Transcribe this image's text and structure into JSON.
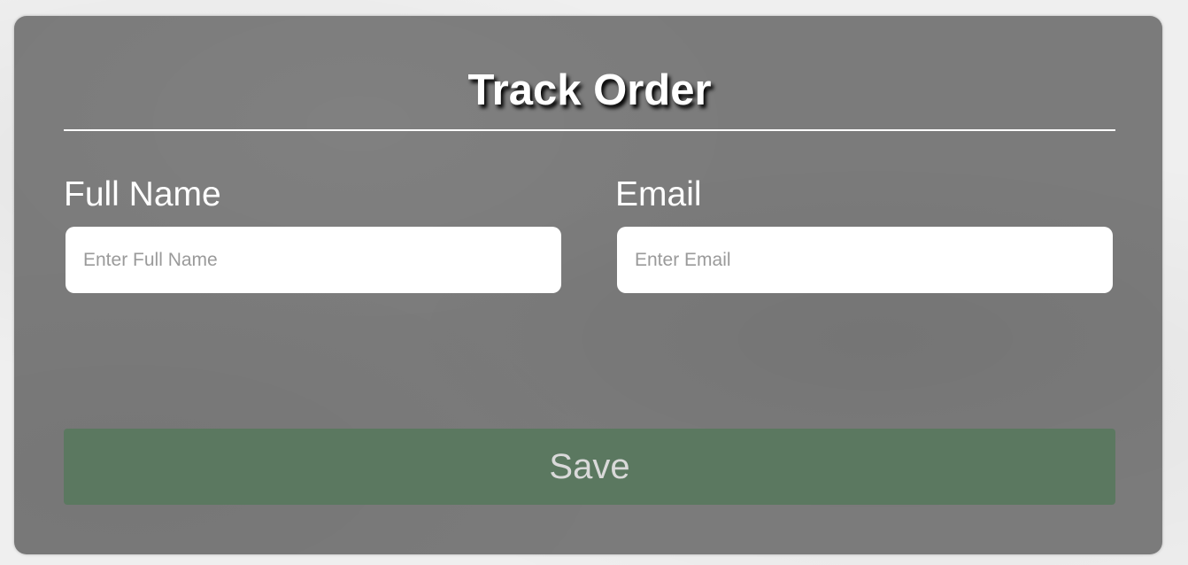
{
  "form": {
    "title": "Track Order",
    "fields": [
      {
        "label": "Full Name",
        "placeholder": "Enter Full Name",
        "value": ""
      },
      {
        "label": "Email",
        "placeholder": "Enter Email",
        "value": ""
      }
    ],
    "save_label": "Save"
  },
  "colors": {
    "panel": "#7b7b7b",
    "button": "#5b7860",
    "button_text": "#d9d9d9",
    "text": "#ffffff"
  }
}
